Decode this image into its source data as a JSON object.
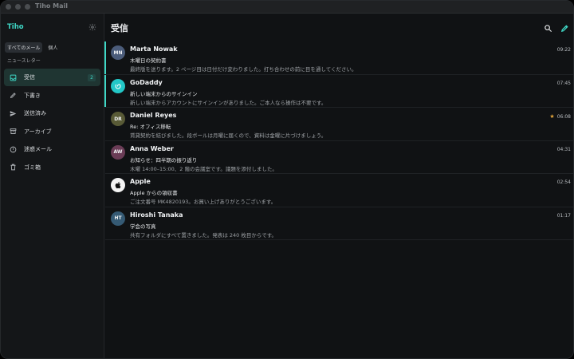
{
  "window": {
    "title": "Tiho Mail"
  },
  "sidebar": {
    "account": "Tiho",
    "filters": [
      "すべてのメール",
      "個人"
    ],
    "newsletter": "ニュースレター",
    "items": [
      {
        "label": "受信",
        "icon": "inbox-icon",
        "badge": "2"
      },
      {
        "label": "下書き",
        "icon": "pencil-icon"
      },
      {
        "label": "送信済み",
        "icon": "send-icon"
      },
      {
        "label": "アーカイブ",
        "icon": "archive-icon"
      },
      {
        "label": "迷惑メール",
        "icon": "alert-icon"
      },
      {
        "label": "ゴミ箱",
        "icon": "trash-icon"
      }
    ]
  },
  "main": {
    "title": "受信",
    "messages": [
      {
        "initials": "MN",
        "color": "#4b5c7a",
        "sender": "Marta Nowak",
        "subject": "木曜日の契約書",
        "preview": "最終版を送ります。2 ページ目は日付だけ変わりました。打ち合わせの前に目を通してください。",
        "time": "09:22",
        "unread": true
      },
      {
        "initials": "",
        "color": "#23c7c7",
        "sender": "GoDaddy",
        "subject": "新しい端末からのサインイン",
        "preview": "新しい端末からアカウントにサインインがありました。ご本人なら操作は不要です。",
        "time": "07:45",
        "unread": true
      },
      {
        "initials": "DR",
        "color": "#585a36",
        "sender": "Daniel Reyes",
        "subject": "Re: オフィス移転",
        "preview": "賃貸契約を結びました。段ボールは月曜に届くので、資料は金曜に片づけましょう。",
        "time": "06:08",
        "starred": true
      },
      {
        "initials": "AW",
        "color": "#6a3c56",
        "sender": "Anna Weber",
        "subject": "お知らせ：四半期の振り返り",
        "preview": "木曜 14:00–15:00、2 階の会議室です。議題を添付しました。",
        "time": "04:31"
      },
      {
        "initials": "",
        "color": "#f4f4f4",
        "sender": "Apple",
        "subject": "Apple からの領収書",
        "preview": "ご注文番号 MK4820193。お買い上げありがとうございます。",
        "time": "02:54"
      },
      {
        "initials": "HT",
        "color": "#355a74",
        "sender": "Hiroshi Tanaka",
        "subject": "学会の写真",
        "preview": "共有フォルダにすべて置きました。発表は 240 枚目からです。",
        "time": "01:17"
      }
    ]
  }
}
